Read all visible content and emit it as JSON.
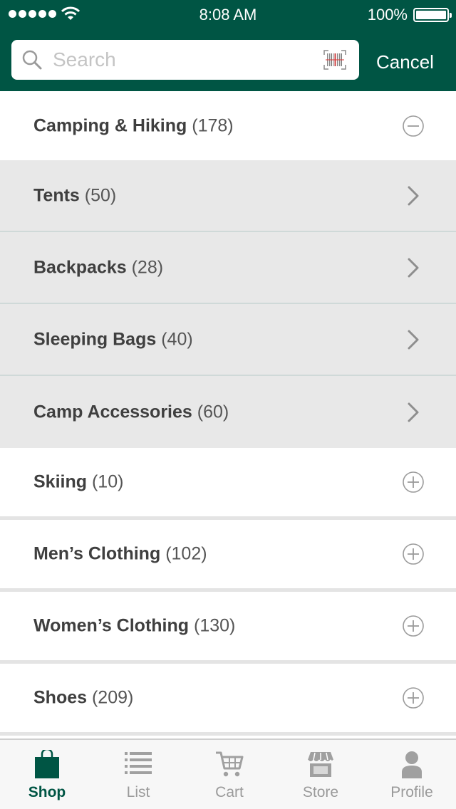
{
  "status_bar": {
    "time": "8:08 AM",
    "battery": "100%",
    "icons": [
      "signal-dots-icon",
      "wifi-icon",
      "battery-icon"
    ]
  },
  "search": {
    "placeholder": "Search",
    "value": "",
    "cancel_label": "Cancel",
    "icons": [
      "search-icon",
      "barcode-scan-icon"
    ]
  },
  "categories": {
    "expanded": {
      "name": "Camping & Hiking",
      "count": "(178)",
      "icon": "minus-circle-icon"
    },
    "subcategories": [
      {
        "name": "Tents",
        "count": " (50)",
        "icon": "chevron-right-icon"
      },
      {
        "name": "Backpacks",
        "count": " (28)",
        "icon": "chevron-right-icon"
      },
      {
        "name": "Sleeping Bags",
        "count": "(40)",
        "icon": "chevron-right-icon"
      },
      {
        "name": "Camp Accessories",
        "count": "(60)",
        "icon": "chevron-right-icon"
      }
    ],
    "collapsed": [
      {
        "name": "Skiing",
        "count": "(10)",
        "icon": "plus-circle-icon"
      },
      {
        "name": "Men’s Clothing",
        "count": "(102)",
        "icon": "plus-circle-icon"
      },
      {
        "name": "Women’s Clothing",
        "count": "(130)",
        "icon": "plus-circle-icon"
      },
      {
        "name": "Shoes",
        "count": "(209)",
        "icon": "plus-circle-icon"
      }
    ]
  },
  "tabbar": {
    "tabs": [
      {
        "label": "Shop",
        "icon": "shopping-bag-icon",
        "active": true
      },
      {
        "label": "List",
        "icon": "list-icon",
        "active": false
      },
      {
        "label": "Cart",
        "icon": "cart-icon",
        "active": false
      },
      {
        "label": "Store",
        "icon": "storefront-icon",
        "active": false
      },
      {
        "label": "Profile",
        "icon": "person-icon",
        "active": false
      }
    ]
  },
  "colors": {
    "brand": "#005544",
    "sub_row_bg": "#e8e8e8",
    "inactive_tab": "#9a9a9a"
  }
}
